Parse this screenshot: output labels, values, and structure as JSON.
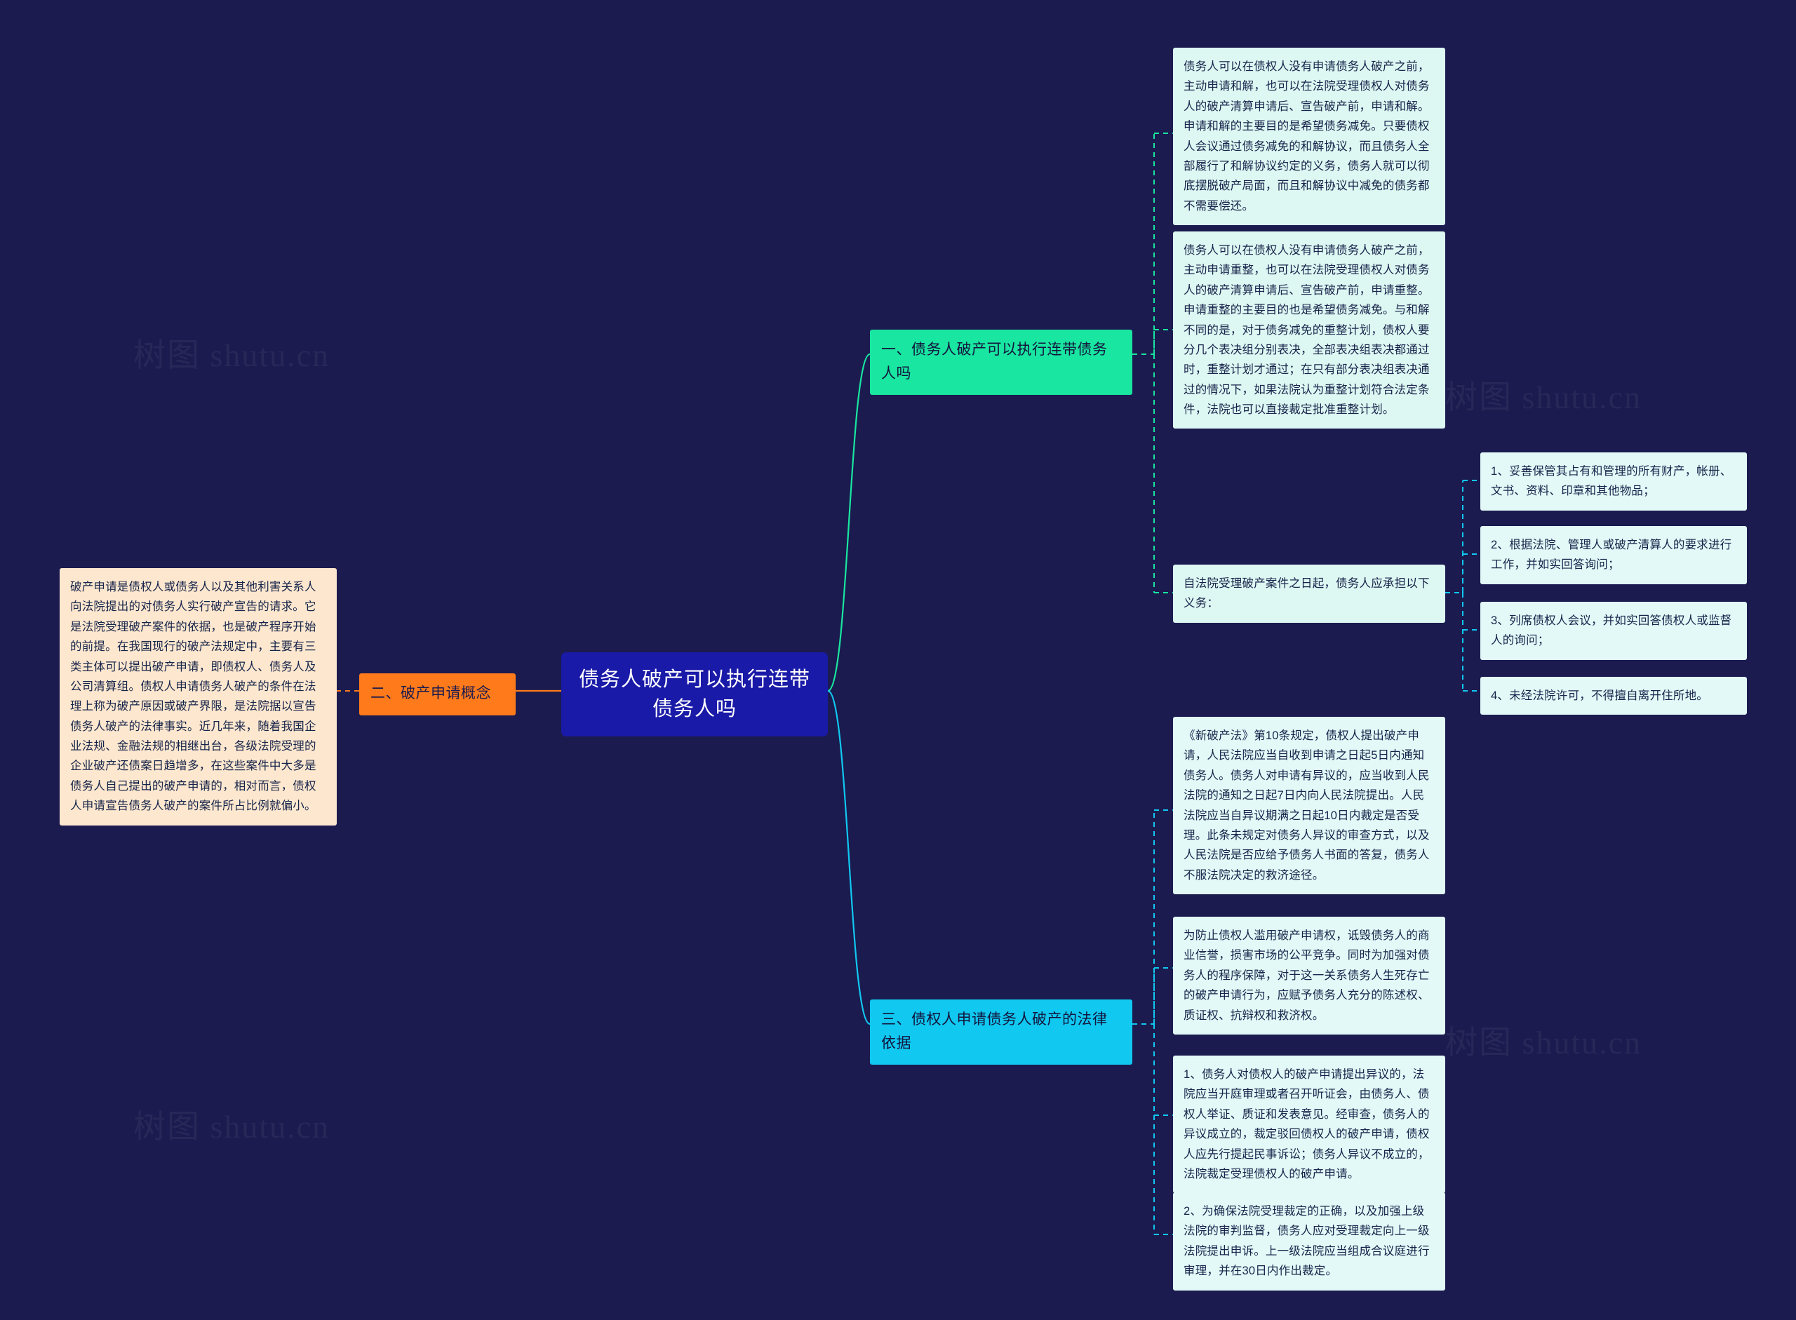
{
  "canvas": {
    "background": "#1b1b4f",
    "watermark_text": "树图 shutu.cn"
  },
  "colors": {
    "root_bg": "#1a1aa8",
    "branch_green": "#19e6a0",
    "branch_cyan": "#10c8f0",
    "branch_orange": "#ff7a1a",
    "leaf_cream": "#fde8cf",
    "leaf_mint": "#ddf7f2",
    "wire_green": "#19e6a0",
    "wire_cyan": "#10c8f0",
    "wire_orange": "#ff7a1a"
  },
  "root": {
    "label": "债务人破产可以执行连带债务人吗"
  },
  "branches": [
    {
      "id": "branch-1",
      "label": "一、债务人破产可以执行连带债务人吗",
      "color": "#19e6a0"
    },
    {
      "id": "branch-2",
      "label": "二、破产申请概念",
      "color": "#ff7a1a"
    },
    {
      "id": "branch-3",
      "label": "三、债权人申请债务人破产的法律依据",
      "color": "#10c8f0"
    }
  ],
  "leaves": {
    "concept": "破产申请是债权人或债务人以及其他利害关系人向法院提出的对债务人实行破产宣告的请求。它是法院受理破产案件的依据，也是破产程序开始的前提。在我国现行的破产法规定中，主要有三类主体可以提出破产申请，即债权人、债务人及公司清算组。债权人申请债务人破产的条件在法理上称为破产原因或破产界限，是法院据以宣告债务人破产的法律事实。近几年来，随着我国企业法规、金融法规的相继出台，各级法院受理的企业破产还债案日趋增多，在这些案件中大多是债务人自己提出的破产申请的，相对而言，债权人申请宣告债务人破产的案件所占比例就偏小。",
    "b1_item1": "债务人可以在债权人没有申请债务人破产之前，主动申请和解，也可以在法院受理债权人对债务人的破产清算申请后、宣告破产前，申请和解。申请和解的主要目的是希望债务减免。只要债权人会议通过债务减免的和解协议，而且债务人全部履行了和解协议约定的义务，债务人就可以彻底摆脱破产局面，而且和解协议中减免的债务都不需要偿还。",
    "b1_item2": "债务人可以在债权人没有申请债务人破产之前，主动申请重整，也可以在法院受理债权人对债务人的破产清算申请后、宣告破产前，申请重整。申请重整的主要目的也是希望债务减免。与和解不同的是，对于债务减免的重整计划，债权人要分几个表决组分别表决，全部表决组表决都通过时，重整计划才通过；在只有部分表决组表决通过的情况下，如果法院认为重整计划符合法定条件，法院也可以直接裁定批准重整计划。",
    "b1_item3": "自法院受理破产案件之日起，债务人应承担以下义务：",
    "b1_sub1": "1、妥善保管其占有和管理的所有财产，帐册、文书、资料、印章和其他物品；",
    "b1_sub2": "2、根据法院、管理人或破产清算人的要求进行工作，并如实回答询问；",
    "b1_sub3": "3、列席债权人会议，并如实回答债权人或监督人的询问；",
    "b1_sub4": "4、未经法院许可，不得擅自离开住所地。",
    "b3_item1": "《新破产法》第10条规定，债权人提出破产申请，人民法院应当自收到申请之日起5日内通知债务人。债务人对申请有异议的，应当收到人民法院的通知之日起7日内向人民法院提出。人民法院应当自异议期满之日起10日内裁定是否受理。此条未规定对债务人异议的审查方式，以及人民法院是否应给予债务人书面的答复，债务人不服法院决定的救济途径。",
    "b3_item2": "为防止债权人滥用破产申请权，诋毁债务人的商业信誉，损害市场的公平竞争。同时为加强对债务人的程序保障，对于这一关系债务人生死存亡的破产申请行为，应赋予债务人充分的陈述权、质证权、抗辩权和救济权。",
    "b3_item3": "1、债务人对债权人的破产申请提出异议的，法院应当开庭审理或者召开听证会，由债务人、债权人举证、质证和发表意见。经审查，债务人的异议成立的，裁定驳回债权人的破产申请，债权人应先行提起民事诉讼；债务人异议不成立的，法院裁定受理债权人的破产申请。",
    "b3_item4": "2、为确保法院受理裁定的正确，以及加强上级法院的审判监督，债务人应对受理裁定向上一级法院提出申诉。上一级法院应当组成合议庭进行审理，并在30日内作出裁定。"
  }
}
